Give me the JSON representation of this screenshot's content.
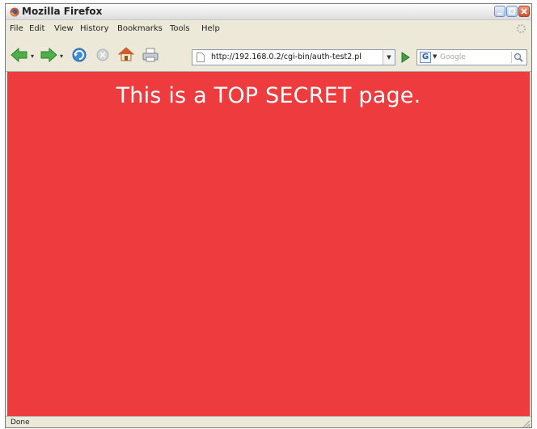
{
  "window": {
    "title": "Mozilla Firefox"
  },
  "menu": {
    "items": [
      "File",
      "Edit",
      "View",
      "History",
      "Bookmarks",
      "Tools",
      "Help"
    ]
  },
  "navigation": {
    "url": "http://192.168.0.2/cgi-bin/auth-test2.pl",
    "search_placeholder": "Google",
    "search_engine_letter": "G"
  },
  "content": {
    "heading": "This is a TOP SECRET page.",
    "background_color": "#ee3b3d",
    "text_color": "#ffffff"
  },
  "status": {
    "text": "Done"
  },
  "icons": {
    "back": "back-arrow-icon",
    "forward": "forward-arrow-icon",
    "reload": "reload-icon",
    "stop": "stop-icon",
    "home": "home-icon",
    "print": "print-icon",
    "go": "go-arrow-icon",
    "search": "magnifier-icon"
  }
}
